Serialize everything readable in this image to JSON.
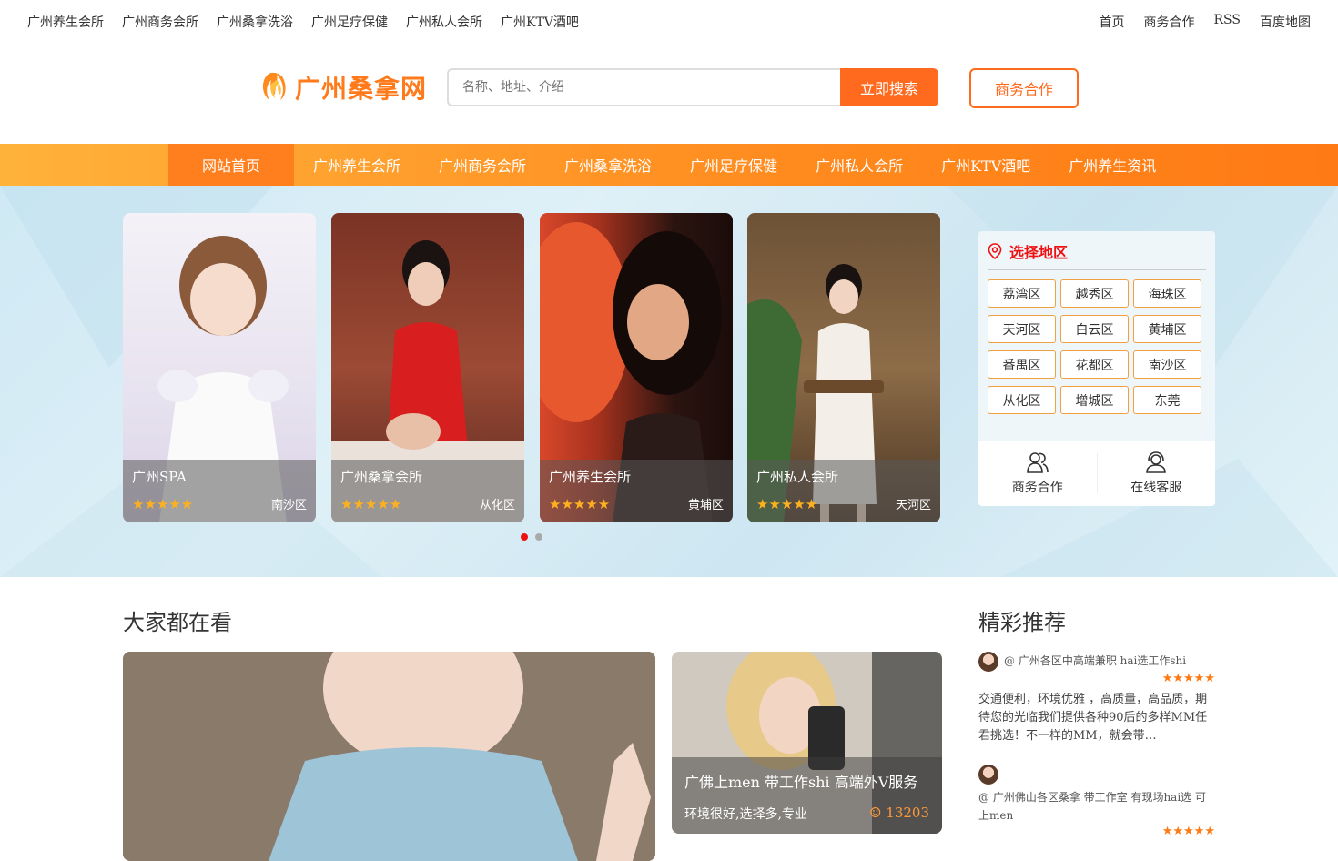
{
  "topbar": {
    "left_links": [
      "广州养生会所",
      "广州商务会所",
      "广州桑拿洗浴",
      "广州足疗保健",
      "广州私人会所",
      "广州KTV酒吧"
    ],
    "right_links": [
      "首页",
      "商务合作",
      "RSS",
      "百度地图"
    ]
  },
  "header": {
    "logo_text": "广州桑拿网",
    "search_placeholder": "名称、地址、介绍",
    "search_button": "立即搜索",
    "biz_button": "商务合作"
  },
  "nav": {
    "items": [
      "网站首页",
      "广州养生会所",
      "广州商务会所",
      "广州桑拿洗浴",
      "广州足疗保健",
      "广州私人会所",
      "广州KTV酒吧",
      "广州养生资讯"
    ]
  },
  "carousel": {
    "cards": [
      {
        "title": "广州SPA",
        "area": "南沙区",
        "stars": "★★★★★"
      },
      {
        "title": "广州桑拿会所",
        "area": "从化区",
        "stars": "★★★★★"
      },
      {
        "title": "广州养生会所",
        "area": "黄埔区",
        "stars": "★★★★★"
      },
      {
        "title": "广州私人会所",
        "area": "天河区",
        "stars": "★★★★★"
      }
    ]
  },
  "region": {
    "title": "选择地区",
    "districts": [
      "荔湾区",
      "越秀区",
      "海珠区",
      "天河区",
      "白云区",
      "黄埔区",
      "番禺区",
      "花都区",
      "南沙区",
      "从化区",
      "增城区",
      "东莞"
    ],
    "footer": {
      "biz": "商务合作",
      "service": "在线客服"
    }
  },
  "popular": {
    "title": "大家都在看",
    "small_card": {
      "title": "广佛上men 带工作shi 高端外V服务",
      "desc": "环境很好,选择多,专业",
      "views": "13203"
    }
  },
  "recommend": {
    "title": "精彩推荐",
    "items": [
      {
        "name": "@ 广州各区中高端兼职 hai选工作shi",
        "stars": "★★★★★",
        "desc": "交通便利，环境优雅 ，高质量，高品质，期待您的光临我们提供各种90后的多样MM任君挑选！不一样的MM，就会带…"
      },
      {
        "name": "@ 广州佛山各区桑拿 带工作室 有现场hai选 可上men",
        "stars": "★★★★★",
        "desc": ""
      }
    ]
  },
  "colors": {
    "accent": "#ff6a1e",
    "nav_start": "#ffb23a",
    "nav_end": "#ff7a14",
    "region_title": "#e11111"
  }
}
